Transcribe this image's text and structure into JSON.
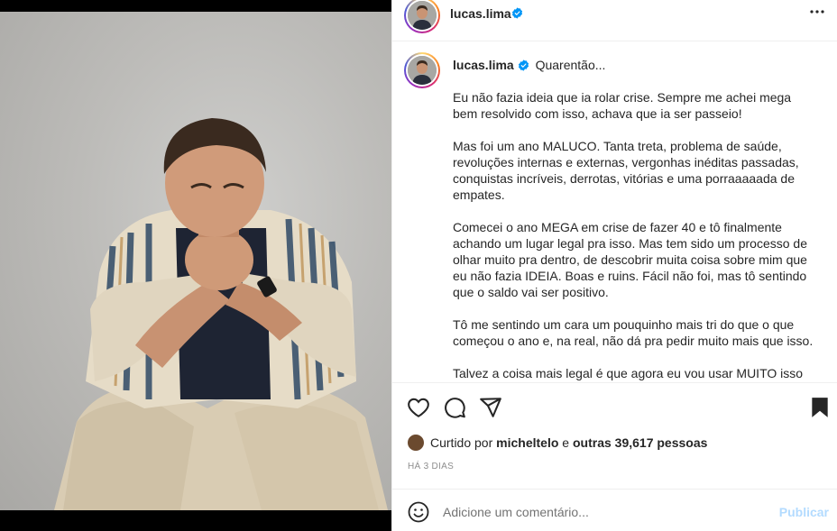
{
  "post": {
    "username": "lucas.lima",
    "location": "Quarentão...",
    "caption_paragraphs": [
      "Eu não fazia ideia que ia rolar crise. Sempre me achei mega bem resolvido com isso, achava que ia ser passeio!",
      "Mas foi um ano MALUCO. Tanta treta, problema de saúde, revoluções internas e externas, vergonhas inéditas passadas, conquistas incríveis, derrotas, vitórias e uma porraaaaada de empates.",
      "Comecei o ano MEGA em crise de fazer 40 e tô finalmente achando um lugar legal pra isso. Mas tem sido um processo de olhar muito pra dentro, de descobrir muita coisa sobre mim que eu não fazia IDEIA. Boas e ruins. Fácil não foi, mas tô sentindo que o saldo vai ser positivo.",
      "Tô me sentindo um cara um pouquinho mais tri do que o que começou o ano e, na real, não dá pra pedir muito mais que isso.",
      "Talvez a coisa mais legal é que agora eu vou usar MUITO isso em"
    ],
    "likes": {
      "prefix": "Curtido por",
      "user": "micheltelo",
      "middle": "e",
      "others": "outras 39,617 pessoas"
    },
    "date": "HÁ 3 DIAS"
  },
  "comment": {
    "placeholder": "Adicione um comentário...",
    "publish_label": "Publicar"
  },
  "icons": {
    "more": "more-options-icon",
    "like": "heart-icon",
    "comment": "comment-icon",
    "share": "send-icon",
    "save": "bookmark-icon",
    "emoji": "emoji-icon",
    "verified": "verified-badge-icon"
  },
  "colors": {
    "verified": "#0095f6",
    "publish_disabled": "#b3dbff",
    "meta_text": "#8e8e8e"
  }
}
